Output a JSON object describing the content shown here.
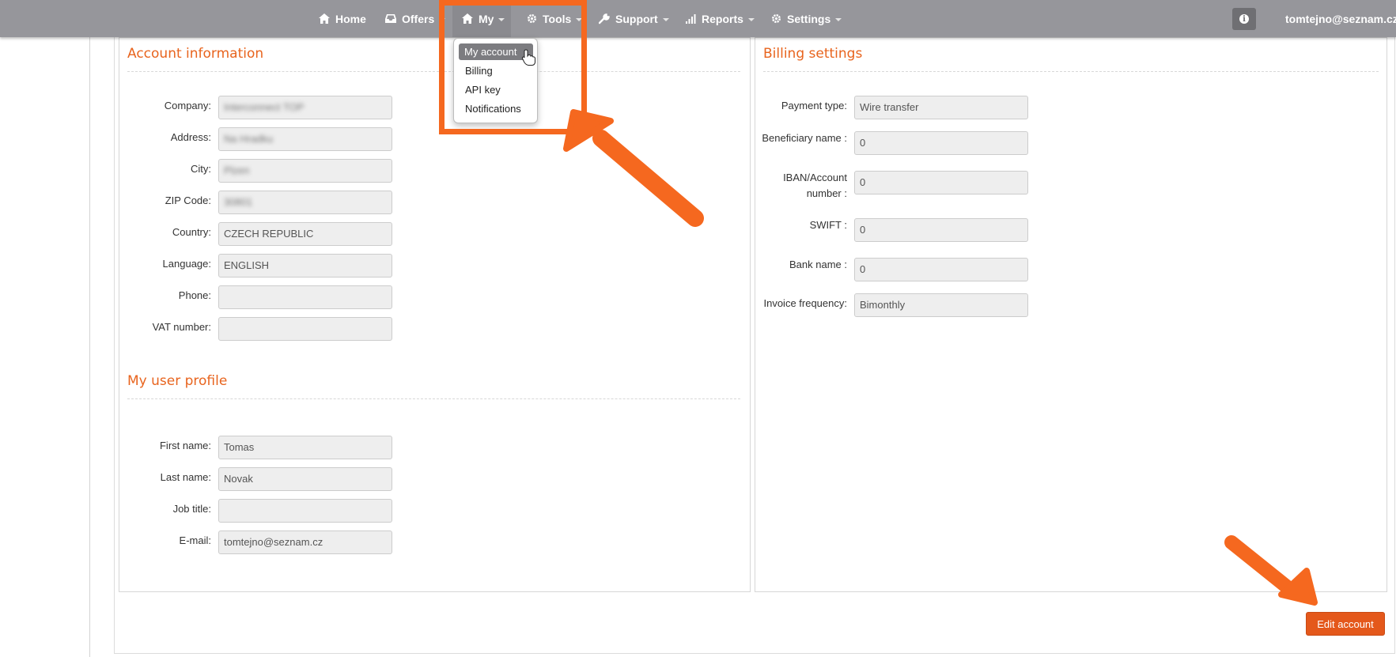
{
  "nav": {
    "items": [
      {
        "label": "Home",
        "icon": "home-icon"
      },
      {
        "label": "Offers",
        "icon": "inbox-icon"
      },
      {
        "label": "My",
        "icon": "home-icon"
      },
      {
        "label": "Tools",
        "icon": "gear-icon"
      },
      {
        "label": "Support",
        "icon": "wrench-icon"
      },
      {
        "label": "Reports",
        "icon": "bar-chart-icon"
      },
      {
        "label": "Settings",
        "icon": "gear-icon"
      }
    ],
    "user": "tomtejno@seznam.cz",
    "info_icon": "info-icon"
  },
  "dropdown": {
    "items": [
      "My account",
      "Billing",
      "API key",
      "Notifications"
    ]
  },
  "account": {
    "title": "Account information",
    "labels": {
      "company": "Company:",
      "address": "Address:",
      "city": "City:",
      "zip": "ZIP Code:",
      "country": "Country:",
      "language": "Language:",
      "phone": "Phone:",
      "vat": "VAT number:"
    },
    "values": {
      "country": "CZECH REPUBLIC",
      "language": "ENGLISH",
      "phone": "",
      "vat": ""
    }
  },
  "profile": {
    "title": "My user profile",
    "labels": {
      "first_name": "First name:",
      "last_name": "Last name:",
      "job_title": "Job title:",
      "email": "E-mail:"
    },
    "values": {
      "first_name": "Tomas",
      "last_name": "Novak",
      "job_title": "",
      "email": "tomtejno@seznam.cz"
    }
  },
  "billing": {
    "title": "Billing settings",
    "labels": {
      "payment_type": "Payment type:",
      "beneficiary": "Beneficiary name :",
      "iban_1": "IBAN/Account",
      "iban_2": "number :",
      "swift": "SWIFT :",
      "bank": "Bank name :",
      "frequency": "Invoice frequency:"
    },
    "values": {
      "payment_type": "Wire transfer",
      "beneficiary": "0",
      "iban": "0",
      "swift": "0",
      "bank": "0",
      "frequency": "Bimonthly"
    }
  },
  "actions": {
    "edit_account": "Edit account"
  },
  "colors": {
    "accent": "#e8641e",
    "annotation": "#f5681f",
    "nav_bg": "#96969b"
  }
}
